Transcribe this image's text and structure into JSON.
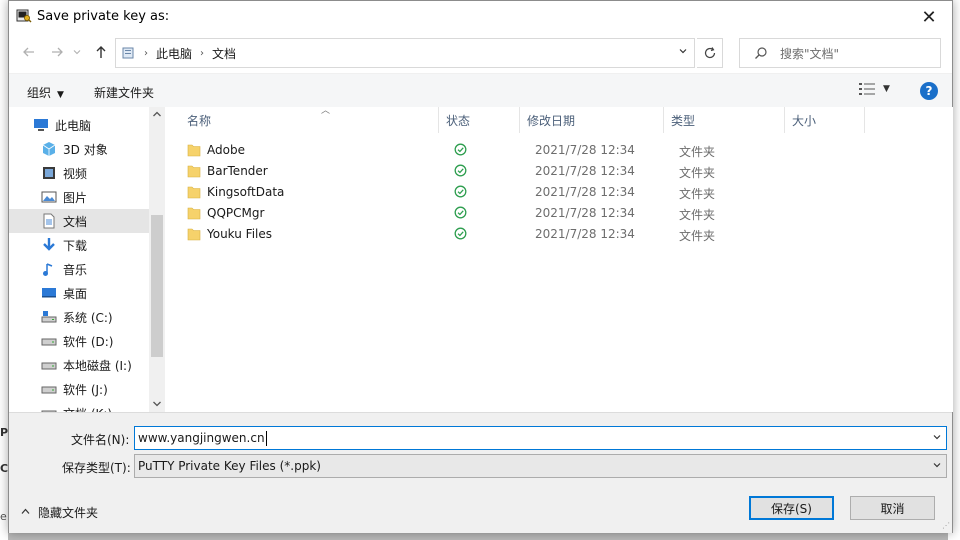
{
  "window": {
    "title": "Save private key as:",
    "close_glyph": "✕"
  },
  "navigation": {
    "breadcrumb": [
      "此电脑",
      "文档"
    ],
    "search_placeholder": "搜索\"文档\""
  },
  "toolbar": {
    "organize_label": "组织",
    "new_folder_label": "新建文件夹",
    "help_glyph": "?"
  },
  "sidebar": {
    "items": [
      {
        "label": "此电脑",
        "icon": "computer-icon"
      },
      {
        "label": "3D 对象",
        "icon": "cube-3d-icon"
      },
      {
        "label": "视频",
        "icon": "video-icon"
      },
      {
        "label": "图片",
        "icon": "picture-icon"
      },
      {
        "label": "文档",
        "icon": "document-icon",
        "selected": true
      },
      {
        "label": "下载",
        "icon": "download-icon"
      },
      {
        "label": "音乐",
        "icon": "music-icon"
      },
      {
        "label": "桌面",
        "icon": "desktop-icon"
      },
      {
        "label": "系统 (C:)",
        "icon": "system-drive-icon"
      },
      {
        "label": "软件 (D:)",
        "icon": "drive-icon"
      },
      {
        "label": "本地磁盘 (I:)",
        "icon": "drive-icon"
      },
      {
        "label": "软件 (J:)",
        "icon": "drive-icon"
      },
      {
        "label": "文档 (K:)",
        "icon": "drive-icon"
      }
    ]
  },
  "file_list": {
    "columns": [
      "名称",
      "状态",
      "修改日期",
      "类型",
      "大小"
    ],
    "rows": [
      {
        "name": "Adobe",
        "status": "synced",
        "date": "2021/7/28 12:34",
        "type": "文件夹"
      },
      {
        "name": "BarTender",
        "status": "synced",
        "date": "2021/7/28 12:34",
        "type": "文件夹"
      },
      {
        "name": "KingsoftData",
        "status": "synced",
        "date": "2021/7/28 12:34",
        "type": "文件夹"
      },
      {
        "name": "QQPCMgr",
        "status": "synced",
        "date": "2021/7/28 12:34",
        "type": "文件夹"
      },
      {
        "name": "Youku Files",
        "status": "synced",
        "date": "2021/7/28 12:34",
        "type": "文件夹"
      }
    ]
  },
  "form": {
    "filename_label": "文件名(N):",
    "filename_value": "www.yangjingwen.cn",
    "filetype_label": "保存类型(T):",
    "filetype_value": "PuTTY Private Key Files (*.ppk)",
    "hide_folders_label": "隐藏文件夹",
    "save_label": "保存(S)",
    "cancel_label": "取消"
  },
  "colors": {
    "accent": "#0078d7",
    "status_ok": "#2e9e4f",
    "folder": "#f6d26b"
  }
}
